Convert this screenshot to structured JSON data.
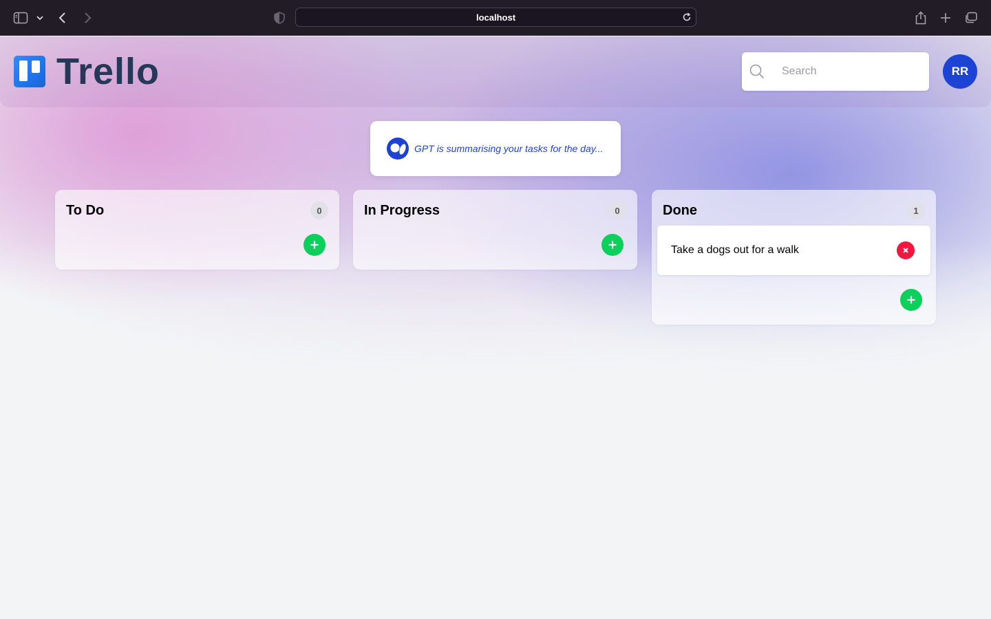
{
  "browser": {
    "url": "localhost"
  },
  "header": {
    "logo_text": "Trello",
    "search_placeholder": "Search",
    "avatar_initials": "RR"
  },
  "summary": {
    "text": "GPT is summarising your tasks for the day..."
  },
  "columns": [
    {
      "title": "To Do",
      "count": "0",
      "cards": []
    },
    {
      "title": "In Progress",
      "count": "0",
      "cards": []
    },
    {
      "title": "Done",
      "count": "1",
      "cards": [
        {
          "text": "Take a dogs out for a walk"
        }
      ]
    }
  ],
  "colors": {
    "accent": "#1d43d4",
    "add": "#0ccf5c",
    "delete": "#f3163f",
    "logo": "#253858"
  }
}
